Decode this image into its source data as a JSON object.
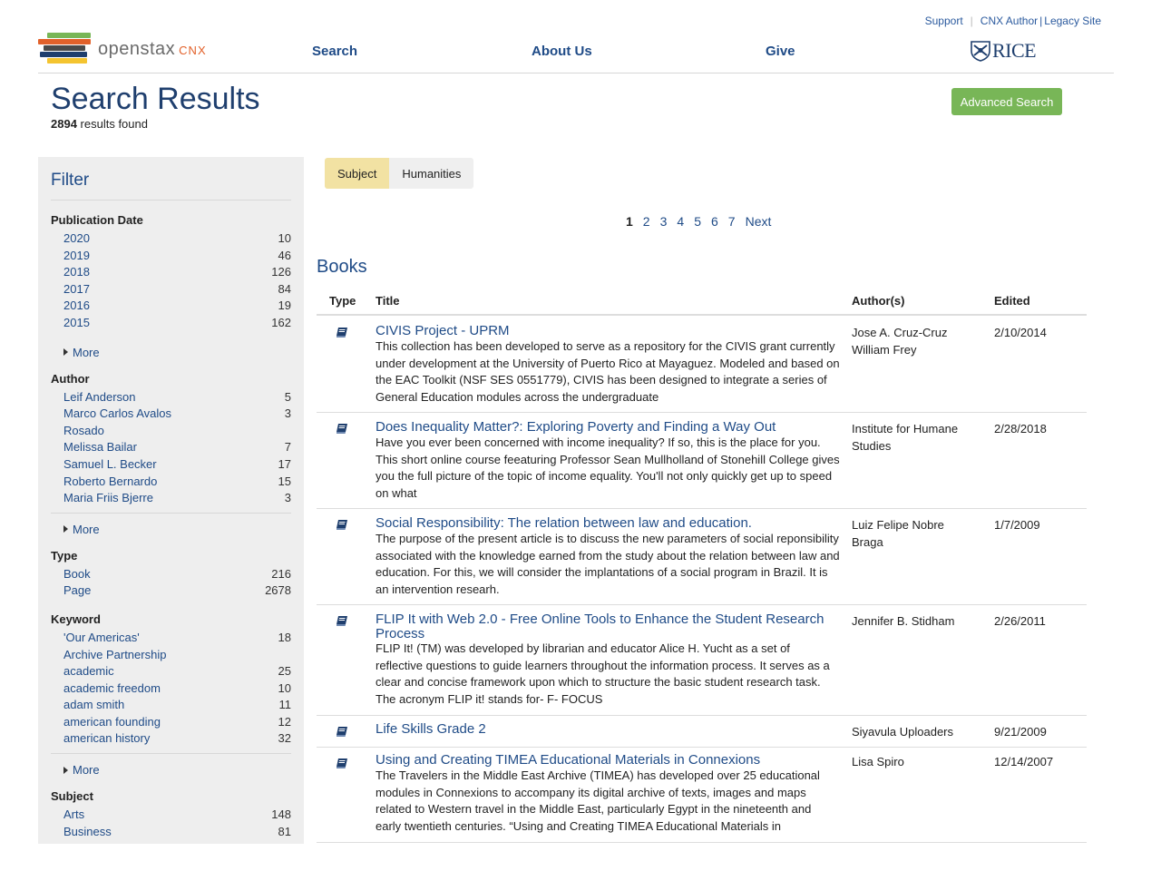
{
  "header": {
    "support": "Support",
    "cnx_author": "CNX Author",
    "legacy_site": "Legacy Site",
    "logo_text": "openstax",
    "logo_suffix": "CNX",
    "nav": [
      "Search",
      "About Us",
      "Give"
    ],
    "rice_text": "RICE"
  },
  "page": {
    "title": "Search Results",
    "result_count": "2894",
    "result_count_suffix": "results found",
    "advanced_search": "Advanced Search"
  },
  "filter": {
    "title": "Filter",
    "more_label": "More",
    "groups": {
      "publication_date": {
        "title": "Publication Date",
        "items": [
          {
            "label": "2020",
            "count": "10"
          },
          {
            "label": "2019",
            "count": "46"
          },
          {
            "label": "2018",
            "count": "126"
          },
          {
            "label": "2017",
            "count": "84"
          },
          {
            "label": "2016",
            "count": "19"
          },
          {
            "label": "2015",
            "count": "162"
          }
        ]
      },
      "author": {
        "title": "Author",
        "items": [
          {
            "label": "Leif Anderson",
            "count": "5"
          },
          {
            "label": "Marco Carlos Avalos",
            "count": "3"
          },
          {
            "label": "Rosado",
            "count": ""
          },
          {
            "label": "Melissa Bailar",
            "count": "7"
          },
          {
            "label": "Samuel L. Becker",
            "count": "17"
          },
          {
            "label": "Roberto Bernardo",
            "count": "15"
          },
          {
            "label": "Maria Friis Bjerre",
            "count": "3"
          }
        ]
      },
      "type": {
        "title": "Type",
        "items": [
          {
            "label": "Book",
            "count": "216"
          },
          {
            "label": "Page",
            "count": "2678"
          }
        ]
      },
      "keyword": {
        "title": "Keyword",
        "items": [
          {
            "label": "'Our Americas'",
            "count": "18"
          },
          {
            "label": "Archive Partnership",
            "count": ""
          },
          {
            "label": "academic",
            "count": "25"
          },
          {
            "label": "academic freedom",
            "count": "10"
          },
          {
            "label": "adam smith",
            "count": "11"
          },
          {
            "label": "american founding",
            "count": "12"
          },
          {
            "label": "american history",
            "count": "32"
          }
        ]
      },
      "subject": {
        "title": "Subject",
        "items": [
          {
            "label": "Arts",
            "count": "148"
          },
          {
            "label": "Business",
            "count": "81"
          }
        ]
      }
    }
  },
  "breadcrumb": {
    "key": "Subject",
    "value": "Humanities"
  },
  "pagination": {
    "pages": [
      "1",
      "2",
      "3",
      "4",
      "5",
      "6",
      "7"
    ],
    "next": "Next",
    "current": "1"
  },
  "results": {
    "section_title": "Books",
    "columns": {
      "type": "Type",
      "title": "Title",
      "authors": "Author(s)",
      "edited": "Edited"
    },
    "rows": [
      {
        "title": "CIVIS Project - UPRM",
        "desc": "This collection has been developed to serve as a repository for the CIVIS grant currently under development at the University of Puerto Rico at Mayaguez. Modeled and based on the EAC Toolkit (NSF SES 0551779), CIVIS has been designed to integrate a series of General Education modules across the undergraduate",
        "authors": "Jose A. Cruz-Cruz\nWilliam Frey",
        "edited": "2/10/2014"
      },
      {
        "title": "Does Inequality Matter?: Exploring Poverty and Finding a Way Out",
        "desc": "Have you ever been concerned with income inequality? If so, this is the place for you. This short online course feeaturing Professor Sean Mullholland of Stonehill College gives you the full picture of the topic of income equality. You'll not only quickly get up to speed on what",
        "authors": "Institute for Humane Studies",
        "edited": "2/28/2018"
      },
      {
        "title": "Social Responsibility: The relation between law and education.",
        "desc": "The purpose of the present article is to discuss the new parameters of social reponsibility associated with the knowledge earned from the study about the relation between law and education. For this, we will consider the implantations of a social program in Brazil. It is an intervention researh.",
        "authors": "Luiz Felipe Nobre Braga",
        "edited": "1/7/2009"
      },
      {
        "title": "FLIP It with Web 2.0 - Free Online Tools to Enhance the Student Research Process",
        "desc": "FLIP It! (TM) was developed by librarian and educator Alice H. Yucht as a set of reflective questions to guide learners throughout the information process. It serves as a clear and concise framework upon which to structure the basic student research task. The acronym FLIP it! stands for- F- FOCUS",
        "authors": "Jennifer B. Stidham",
        "edited": "2/26/2011"
      },
      {
        "title": "Life Skills Grade 2",
        "desc": "",
        "authors": "Siyavula Uploaders",
        "edited": "9/21/2009"
      },
      {
        "title": "Using and Creating TIMEA Educational Materials in Connexions",
        "desc": "The Travelers in the Middle East Archive (TIMEA) has developed over 25 educational modules in Connexions to accompany its digital archive of texts, images and maps related to Western travel in the Middle East, particularly Egypt in the nineteenth and early twentieth centuries. “Using and Creating TIMEA Educational Materials in",
        "authors": "Lisa Spiro",
        "edited": "12/14/2007"
      }
    ]
  },
  "colors": {
    "brand_blue": "#1f4b87",
    "title_blue": "#1f3f6e",
    "advanced_green": "#78b657",
    "crumb_yellow": "#f2e2a3",
    "logo_orange": "#e2612a"
  }
}
